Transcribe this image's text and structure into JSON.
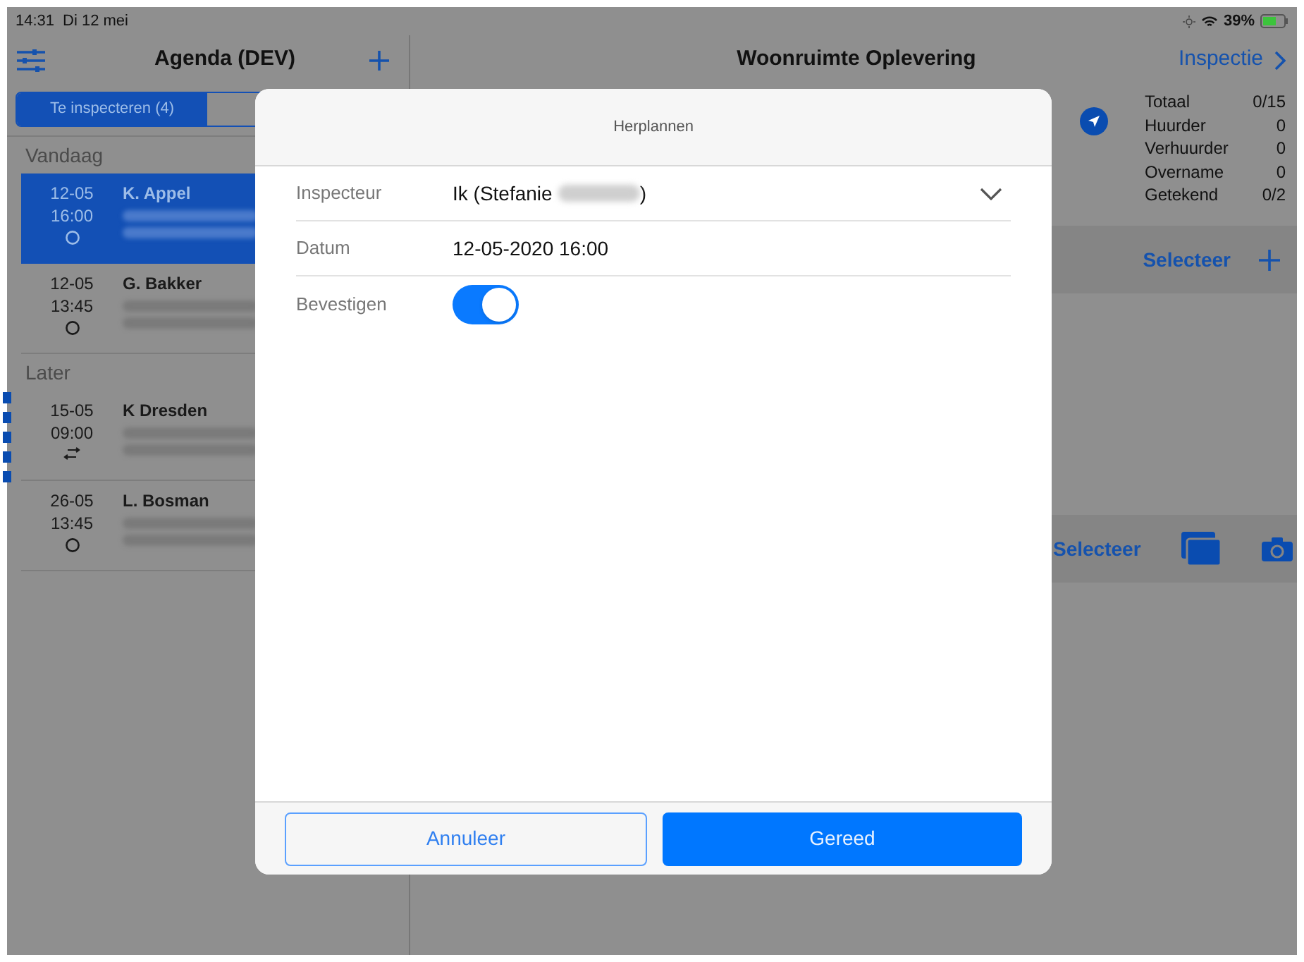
{
  "status_bar": {
    "time": "14:31",
    "date": "Di 12 mei",
    "battery": "39%"
  },
  "sidebar": {
    "title": "Agenda (DEV)",
    "tabs": [
      {
        "label": "Te inspecteren (4)",
        "selected": true
      },
      {
        "selected": false
      }
    ],
    "sections": [
      {
        "title": "Vandaag",
        "items": [
          {
            "date": "12-05",
            "time": "16:00",
            "name": "K. Appel",
            "kind": "circle",
            "selected": true,
            "flagged": false
          },
          {
            "date": "12-05",
            "time": "13:45",
            "name": "G. Bakker",
            "kind": "circle",
            "selected": false,
            "flagged": false
          }
        ]
      },
      {
        "title": "Later",
        "items": [
          {
            "date": "15-05",
            "time": "09:00",
            "name": "K Dresden",
            "kind": "transfer",
            "selected": false,
            "flagged": true
          },
          {
            "date": "26-05",
            "time": "13:45",
            "name": "L. Bosman",
            "kind": "circle",
            "selected": false,
            "flagged": false
          }
        ]
      }
    ]
  },
  "detail": {
    "title": "Woonruimte Oplevering",
    "next_link": "Inspectie",
    "stats": [
      {
        "label": "Totaal",
        "value": "0/15"
      },
      {
        "label": "Huurder",
        "value": "0"
      },
      {
        "label": "Verhuurder",
        "value": "0"
      },
      {
        "label": "Overname",
        "value": "0"
      },
      {
        "label": "Getekend",
        "value": "0/2"
      }
    ],
    "select_top": "Selecteer",
    "select_bottom": "Selecteer"
  },
  "dialog": {
    "title": "Herplannen",
    "fields": [
      {
        "kind": "select",
        "label": "Inspecteur",
        "value": "Ik (Stefanie",
        "value_end": ")"
      },
      {
        "kind": "text",
        "label": "Datum",
        "value": "12-05-2020 16:00"
      },
      {
        "kind": "switch",
        "label": "Bevestigen",
        "on": true
      }
    ],
    "buttons": [
      {
        "label": "Annuleer",
        "kind": "secondary"
      },
      {
        "label": "Gereed",
        "kind": "primary"
      }
    ]
  }
}
